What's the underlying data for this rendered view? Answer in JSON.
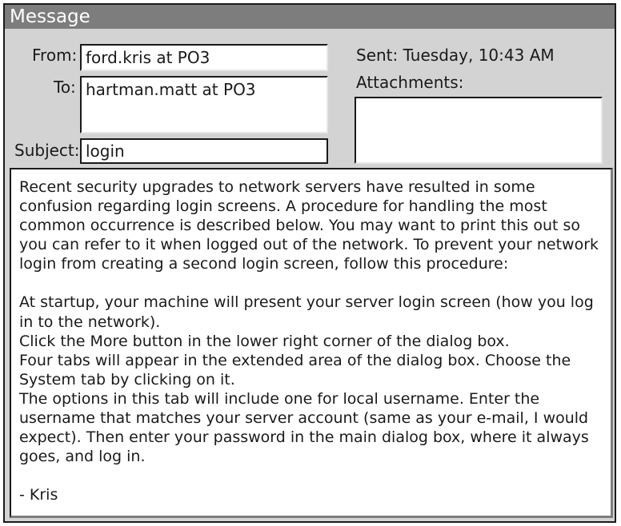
{
  "window": {
    "title": "Message"
  },
  "header": {
    "from_label": "From:",
    "from_value": "ford.kris at PO3",
    "to_label": "To:",
    "to_value": "hartman.matt at PO3",
    "subject_label": "Subject:",
    "subject_value": "login",
    "sent_text": "Sent: Tuesday, 10:43 AM",
    "attachments_label": "Attachments:"
  },
  "body": {
    "paragraph_1": "Recent security upgrades to network servers have resulted in some confusion regarding login screens.  A procedure for handling the most common occurrence is described below.  You may want to print this out so you can refer to it when logged out of the network.  To prevent your network login from creating a second login screen, follow this procedure:",
    "step_1": "At startup, your machine will present your server login screen (how you log in to the network).",
    "step_2": "Click the More button in the lower right corner of the dialog box.",
    "step_3": "Four tabs will appear in the extended area of the dialog box.  Choose the System tab by clicking on it.",
    "step_4": "The options in this tab will include one for local username.  Enter the username that matches your server account (same as your e-mail, I would expect). Then enter your password in the main dialog box, where it always goes, and log in.",
    "signature": "- Kris"
  }
}
